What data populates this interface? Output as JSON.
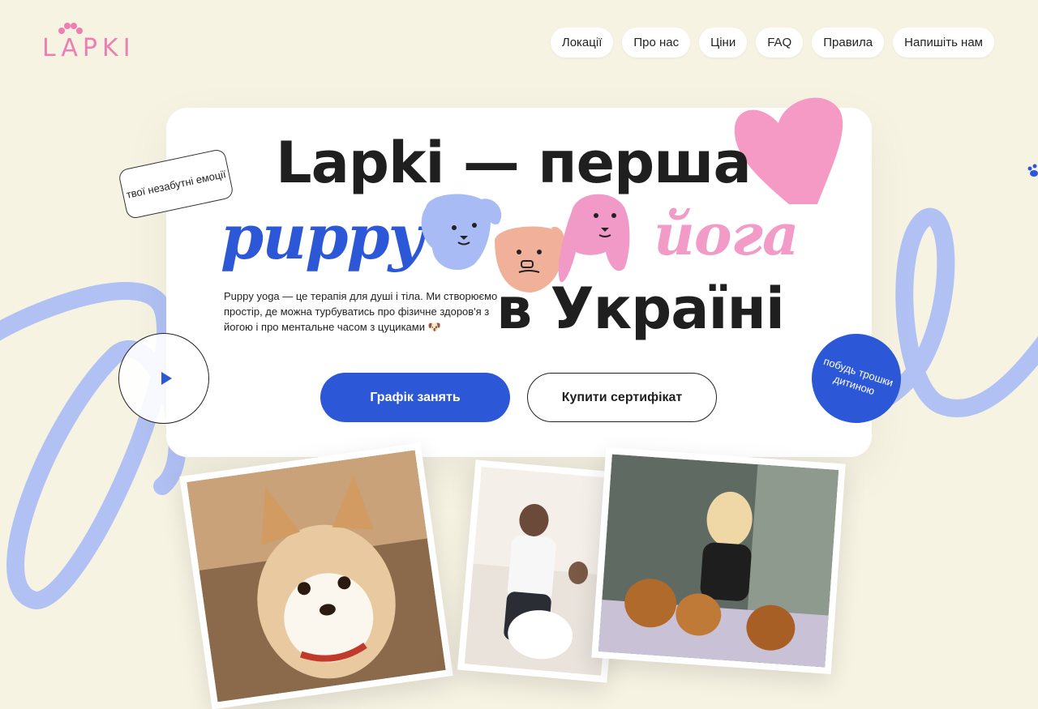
{
  "brand": {
    "logo_text": "LAPKI"
  },
  "nav": {
    "items": [
      "Локації",
      "Про нас",
      "Ціни",
      "FAQ",
      "Правила",
      "Напишіть нам"
    ]
  },
  "hero": {
    "title_line1": "Lapki — перша",
    "title_puppy": "puppy",
    "title_yoga": "йога",
    "title_line3": "в Україні",
    "tag_note": "твої незабутні емоції",
    "description": "Puppy yoga — це терапія для душі і тіла. Ми створюємо простір, де можна турбуватись про фізичне здоров'я з йогою і про ментальне часом з цуциками 🐶",
    "primary_button": "Графік занять",
    "secondary_button": "Купити сертифікат",
    "badge_text": "побудь трошки дитиною"
  },
  "colors": {
    "accent_blue": "#2c58d8",
    "accent_pink": "#f19bc6",
    "background": "#f7f3e3",
    "swirl": "#a9bbf5"
  },
  "icons": {
    "play": "play-icon",
    "paw": "paw-icon",
    "heart": "heart-icon"
  }
}
